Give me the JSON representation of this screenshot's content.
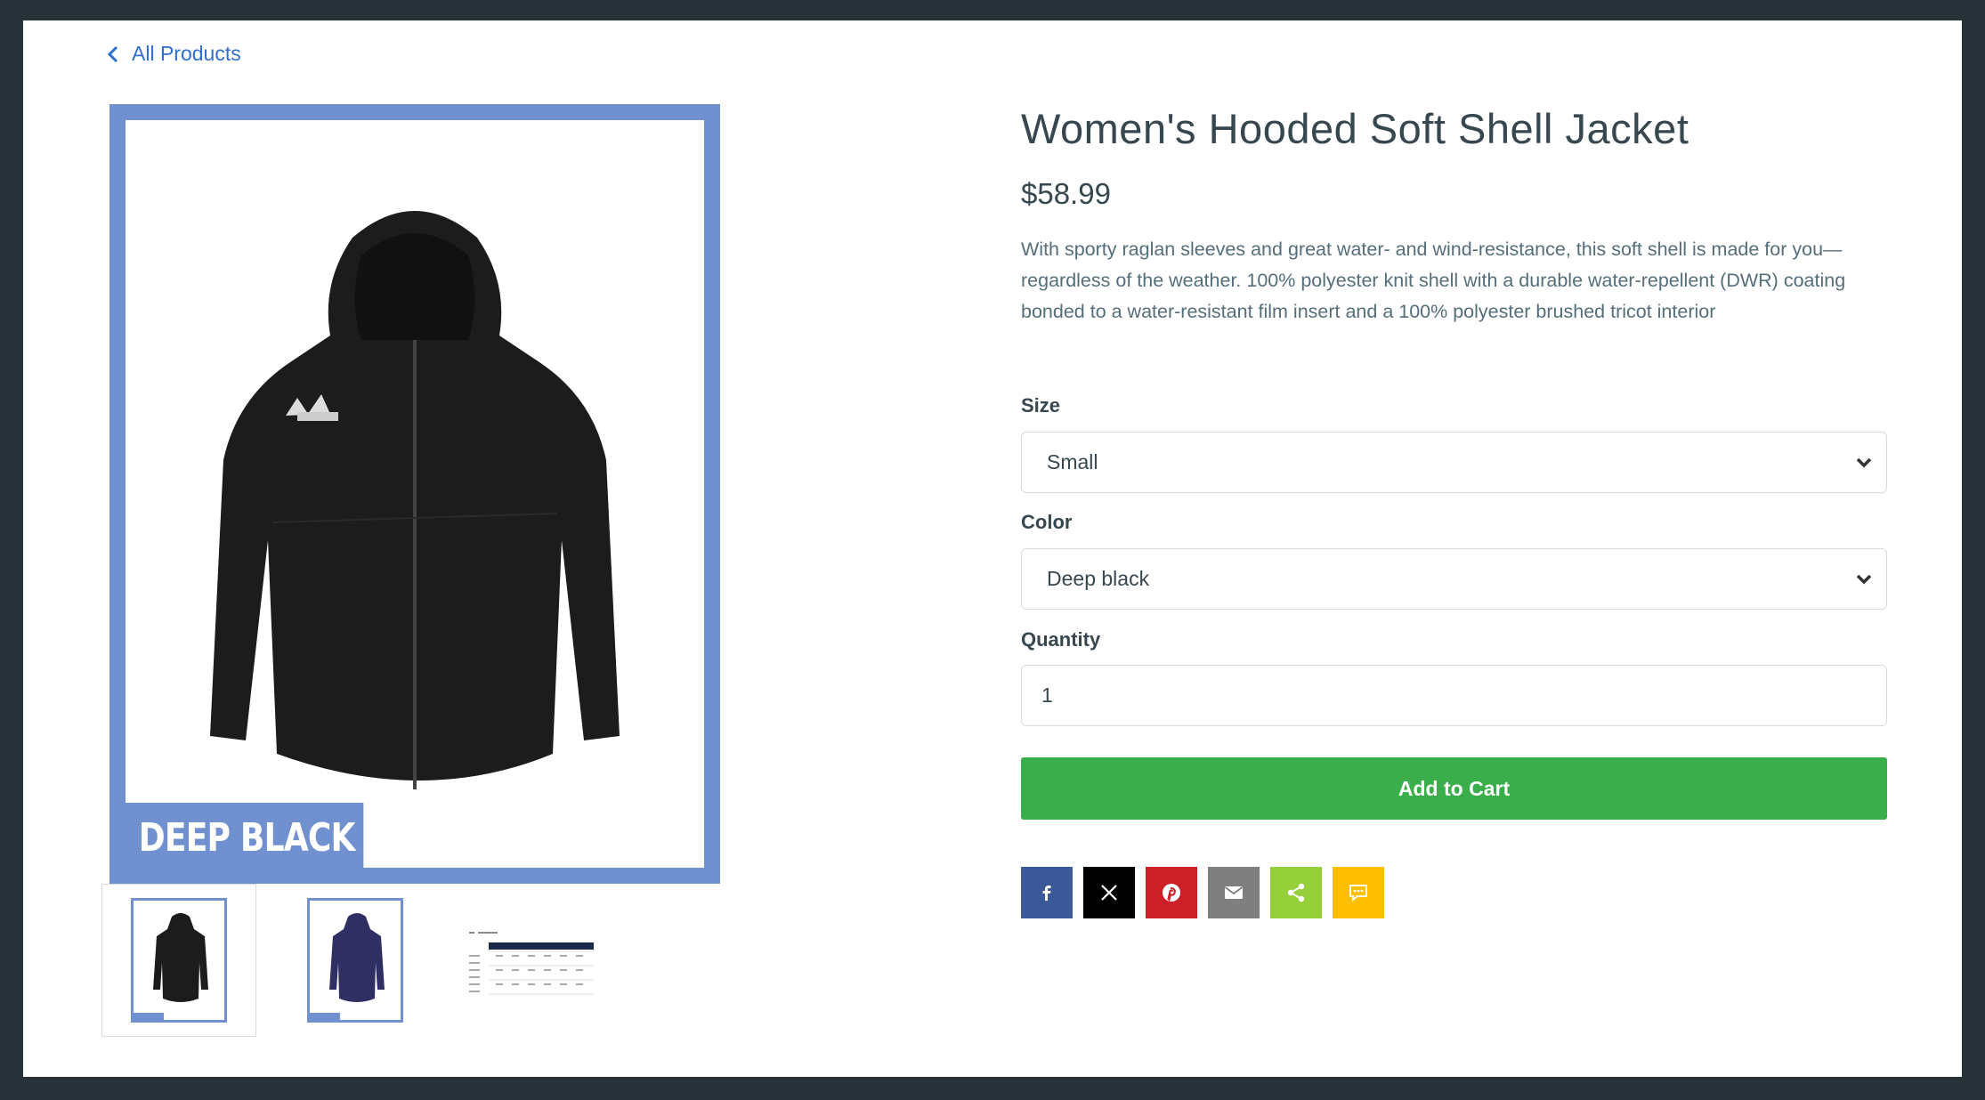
{
  "nav": {
    "back_label": "All Products"
  },
  "product": {
    "title": "Women's Hooded Soft Shell Jacket",
    "price": "$58.99",
    "description": "With sporty raglan sleeves and great water- and wind-resistance, this soft shell is made for you—regardless of the weather. 100% polyester knit shell with a durable water-repellent (DWR) coating bonded to a water-resistant film insert and a 100% polyester brushed tricot interior",
    "image_color_tag": "DEEP BLACK"
  },
  "options": {
    "size_label": "Size",
    "size_value": "Small",
    "color_label": "Color",
    "color_value": "Deep black",
    "quantity_label": "Quantity",
    "quantity_value": "1"
  },
  "cart": {
    "add_label": "Add to Cart"
  },
  "thumbnails": [
    {
      "name": "thumbnail-deep-black",
      "color": "#1c1c1c"
    },
    {
      "name": "thumbnail-navy",
      "color": "#2f2f63"
    },
    {
      "name": "thumbnail-size-chart",
      "color": "#1b2a4a"
    }
  ],
  "share": [
    {
      "name": "facebook-share-button",
      "icon": "facebook-icon",
      "color": "#3b5998"
    },
    {
      "name": "x-share-button",
      "icon": "x-icon",
      "color": "#000000"
    },
    {
      "name": "pinterest-share-button",
      "icon": "pinterest-icon",
      "color": "#cb2027"
    },
    {
      "name": "email-share-button",
      "icon": "email-icon",
      "color": "#7f7f7f"
    },
    {
      "name": "share-button",
      "icon": "share-icon",
      "color": "#95d03a"
    },
    {
      "name": "sms-share-button",
      "icon": "sms-icon",
      "color": "#ffbe00"
    }
  ],
  "colors": {
    "accent": "#3aae4a",
    "link": "#2f6fcf",
    "image_frame": "#7090cf"
  }
}
